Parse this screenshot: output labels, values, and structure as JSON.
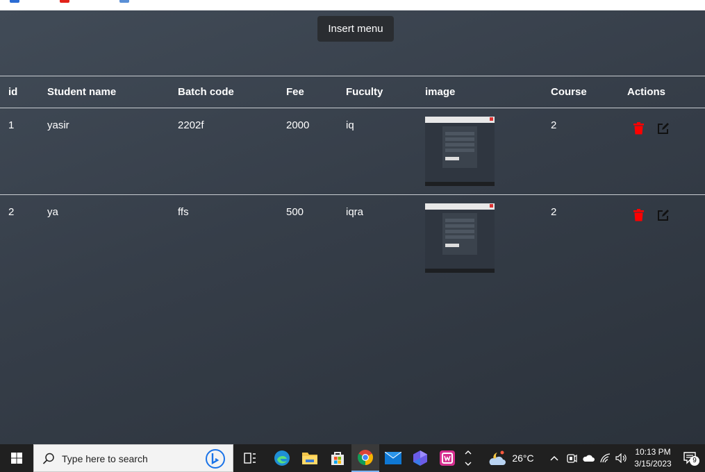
{
  "app": {
    "insert_button": "Insert menu",
    "columns": [
      "id",
      "Student name",
      "Batch code",
      "Fee",
      "Fuculty",
      "image",
      "Course",
      "Actions"
    ],
    "rows": [
      {
        "id": "1",
        "name": "yasir",
        "batch": "2202f",
        "fee": "2000",
        "faculty": "iq",
        "course": "2"
      },
      {
        "id": "2",
        "name": "ya",
        "batch": "ffs",
        "fee": "500",
        "faculty": "iqra",
        "course": "2"
      }
    ],
    "icons": {
      "delete": "trash-icon",
      "edit": "edit-icon"
    },
    "colors": {
      "delete": "#ff0000",
      "edit": "#111111"
    }
  },
  "taskbar": {
    "search_placeholder": "Type here to search",
    "weather": "26°C",
    "time": "10:13 PM",
    "date": "3/15/2023",
    "notification_count": "9"
  }
}
